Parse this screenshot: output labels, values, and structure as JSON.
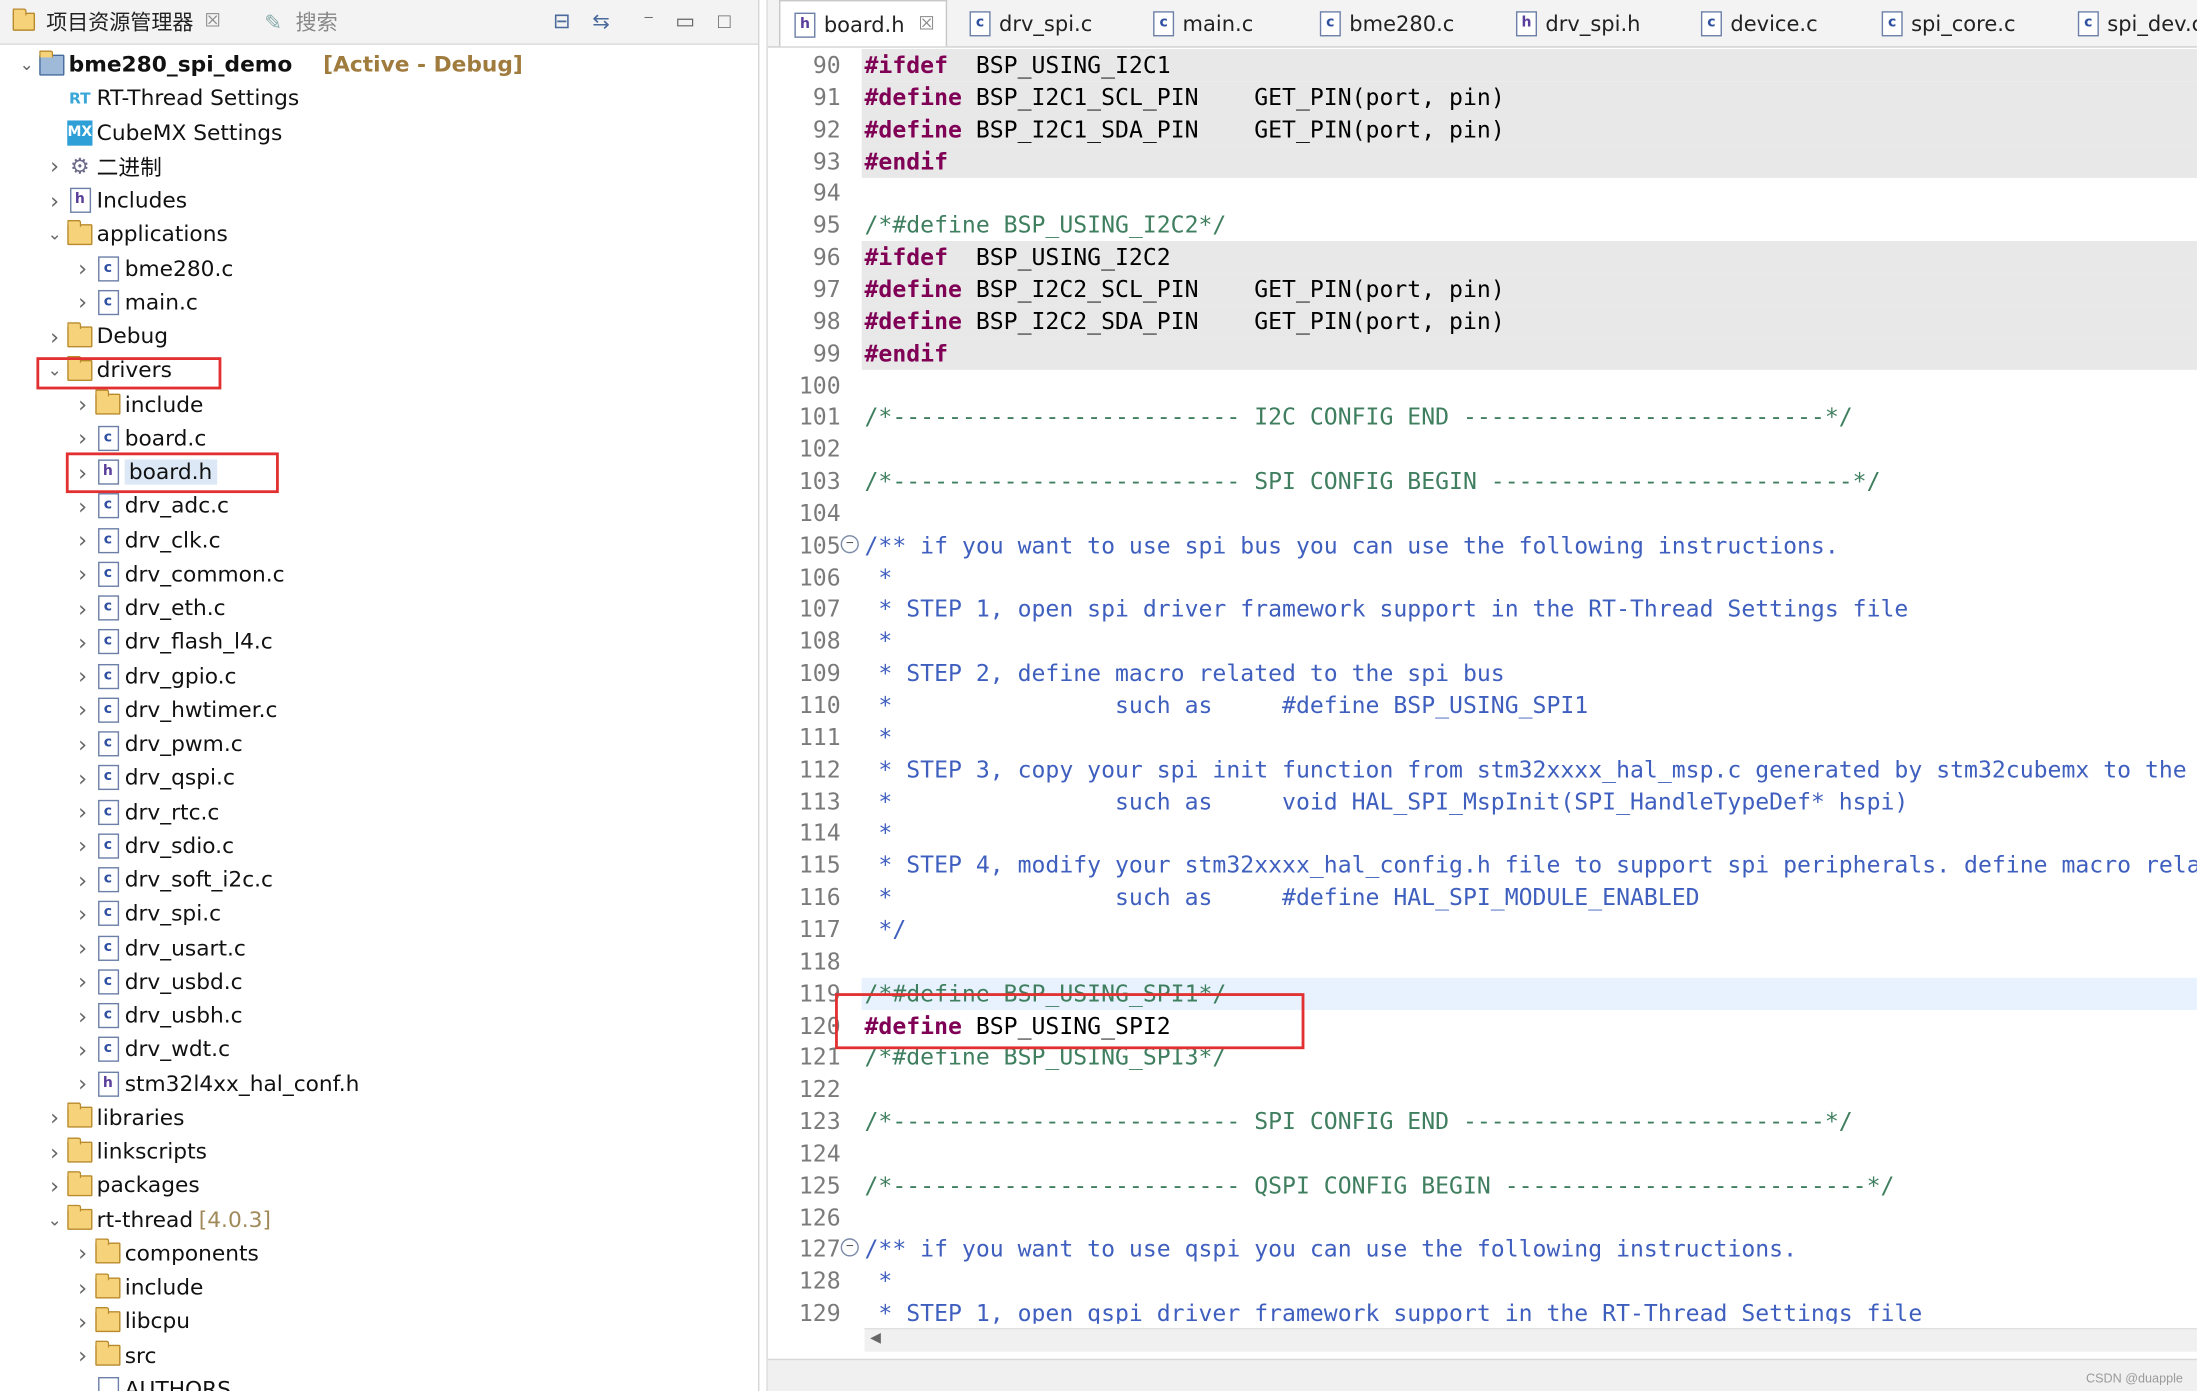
{
  "left_panel": {
    "tab_active": "项目资源管理器",
    "tab_close": "☒",
    "tab_inactive": "搜索",
    "tree": [
      {
        "label": "bme280_spi_demo",
        "annot": "[Active - Debug]",
        "depth": 0,
        "chev": "open",
        "icon": "project"
      },
      {
        "label": "RT-Thread Settings",
        "depth": 1,
        "chev": "none",
        "icon": "rt"
      },
      {
        "label": "CubeMX Settings",
        "depth": 1,
        "chev": "none",
        "icon": "mx"
      },
      {
        "label": "二进制",
        "depth": 1,
        "chev": "closed",
        "icon": "gear"
      },
      {
        "label": "Includes",
        "depth": 1,
        "chev": "closed",
        "icon": "includes"
      },
      {
        "label": "applications",
        "depth": 1,
        "chev": "open",
        "icon": "folder"
      },
      {
        "label": "bme280.c",
        "depth": 2,
        "chev": "closed",
        "icon": "c"
      },
      {
        "label": "main.c",
        "depth": 2,
        "chev": "closed",
        "icon": "c"
      },
      {
        "label": "Debug",
        "depth": 1,
        "chev": "closed",
        "icon": "folder"
      },
      {
        "label": "drivers",
        "depth": 1,
        "chev": "open",
        "icon": "folder"
      },
      {
        "label": "include",
        "depth": 2,
        "chev": "closed",
        "icon": "folder"
      },
      {
        "label": "board.c",
        "depth": 2,
        "chev": "closed",
        "icon": "c"
      },
      {
        "label": "board.h",
        "depth": 2,
        "chev": "closed",
        "icon": "h",
        "selected": true
      },
      {
        "label": "drv_adc.c",
        "depth": 2,
        "chev": "closed",
        "icon": "c"
      },
      {
        "label": "drv_clk.c",
        "depth": 2,
        "chev": "closed",
        "icon": "c"
      },
      {
        "label": "drv_common.c",
        "depth": 2,
        "chev": "closed",
        "icon": "c"
      },
      {
        "label": "drv_eth.c",
        "depth": 2,
        "chev": "closed",
        "icon": "c"
      },
      {
        "label": "drv_flash_l4.c",
        "depth": 2,
        "chev": "closed",
        "icon": "c"
      },
      {
        "label": "drv_gpio.c",
        "depth": 2,
        "chev": "closed",
        "icon": "c"
      },
      {
        "label": "drv_hwtimer.c",
        "depth": 2,
        "chev": "closed",
        "icon": "c"
      },
      {
        "label": "drv_pwm.c",
        "depth": 2,
        "chev": "closed",
        "icon": "c"
      },
      {
        "label": "drv_qspi.c",
        "depth": 2,
        "chev": "closed",
        "icon": "c"
      },
      {
        "label": "drv_rtc.c",
        "depth": 2,
        "chev": "closed",
        "icon": "c"
      },
      {
        "label": "drv_sdio.c",
        "depth": 2,
        "chev": "closed",
        "icon": "c"
      },
      {
        "label": "drv_soft_i2c.c",
        "depth": 2,
        "chev": "closed",
        "icon": "c"
      },
      {
        "label": "drv_spi.c",
        "depth": 2,
        "chev": "closed",
        "icon": "c"
      },
      {
        "label": "drv_usart.c",
        "depth": 2,
        "chev": "closed",
        "icon": "c"
      },
      {
        "label": "drv_usbd.c",
        "depth": 2,
        "chev": "closed",
        "icon": "c"
      },
      {
        "label": "drv_usbh.c",
        "depth": 2,
        "chev": "closed",
        "icon": "c"
      },
      {
        "label": "drv_wdt.c",
        "depth": 2,
        "chev": "closed",
        "icon": "c"
      },
      {
        "label": "stm32l4xx_hal_conf.h",
        "depth": 2,
        "chev": "closed",
        "icon": "h"
      },
      {
        "label": "libraries",
        "depth": 1,
        "chev": "closed",
        "icon": "folder"
      },
      {
        "label": "linkscripts",
        "depth": 1,
        "chev": "closed",
        "icon": "folder"
      },
      {
        "label": "packages",
        "depth": 1,
        "chev": "closed",
        "icon": "folder"
      },
      {
        "label": "rt-thread",
        "annot": "[4.0.3]",
        "depth": 1,
        "chev": "open",
        "icon": "folder"
      },
      {
        "label": "components",
        "depth": 2,
        "chev": "closed",
        "icon": "folder"
      },
      {
        "label": "include",
        "depth": 2,
        "chev": "closed",
        "icon": "folder"
      },
      {
        "label": "libcpu",
        "depth": 2,
        "chev": "closed",
        "icon": "folder"
      },
      {
        "label": "src",
        "depth": 2,
        "chev": "closed",
        "icon": "folder"
      },
      {
        "label": "AUTHORS",
        "depth": 2,
        "chev": "none",
        "icon": "file"
      }
    ]
  },
  "editor": {
    "tabs": [
      {
        "label": "board.h",
        "icon": "h",
        "active": true,
        "close": "☒"
      },
      {
        "label": "drv_spi.c",
        "icon": "c"
      },
      {
        "label": "main.c",
        "icon": "c"
      },
      {
        "label": "bme280.c",
        "icon": "c"
      },
      {
        "label": "drv_spi.h",
        "icon": "h"
      },
      {
        "label": "device.c",
        "icon": "c"
      },
      {
        "label": "spi_core.c",
        "icon": "c"
      },
      {
        "label": "spi_dev.c",
        "icon": "c"
      }
    ],
    "lines": [
      {
        "n": "90",
        "shade": true,
        "parts": [
          [
            "kw",
            "#ifdef"
          ],
          [
            "",
            "  BSP_USING_I2C1"
          ]
        ]
      },
      {
        "n": "91",
        "shade": true,
        "parts": [
          [
            "kw",
            "#define"
          ],
          [
            "",
            " BSP_I2C1_SCL_PIN    GET_PIN(port, pin)"
          ]
        ]
      },
      {
        "n": "92",
        "shade": true,
        "parts": [
          [
            "kw",
            "#define"
          ],
          [
            "",
            " BSP_I2C1_SDA_PIN    GET_PIN(port, pin)"
          ]
        ]
      },
      {
        "n": "93",
        "shade": true,
        "parts": [
          [
            "kw",
            "#endif"
          ]
        ]
      },
      {
        "n": "94",
        "parts": []
      },
      {
        "n": "95",
        "parts": [
          [
            "cmg",
            "/*#define BSP_USING_I2C2*/"
          ]
        ]
      },
      {
        "n": "96",
        "shade": true,
        "parts": [
          [
            "kw",
            "#ifdef"
          ],
          [
            "",
            "  BSP_USING_I2C2"
          ]
        ]
      },
      {
        "n": "97",
        "shade": true,
        "parts": [
          [
            "kw",
            "#define"
          ],
          [
            "",
            " BSP_I2C2_SCL_PIN    GET_PIN(port, pin)"
          ]
        ]
      },
      {
        "n": "98",
        "shade": true,
        "parts": [
          [
            "kw",
            "#define"
          ],
          [
            "",
            " BSP_I2C2_SDA_PIN    GET_PIN(port, pin)"
          ]
        ]
      },
      {
        "n": "99",
        "shade": true,
        "parts": [
          [
            "kw",
            "#endif"
          ]
        ]
      },
      {
        "n": "100",
        "parts": []
      },
      {
        "n": "101",
        "parts": [
          [
            "cmg",
            "/*------------------------- I2C CONFIG END --------------------------*/"
          ]
        ]
      },
      {
        "n": "102",
        "parts": []
      },
      {
        "n": "103",
        "parts": [
          [
            "cmg",
            "/*------------------------- SPI CONFIG BEGIN --------------------------*/"
          ]
        ]
      },
      {
        "n": "104",
        "parts": []
      },
      {
        "n": "105",
        "fold": true,
        "parts": [
          [
            "cm",
            "/** if you want to use spi bus you can use the following instructions."
          ]
        ]
      },
      {
        "n": "106",
        "parts": [
          [
            "cm",
            " *"
          ]
        ]
      },
      {
        "n": "107",
        "parts": [
          [
            "cm",
            " * STEP 1, open spi driver framework support in the RT-Thread Settings file"
          ]
        ]
      },
      {
        "n": "108",
        "parts": [
          [
            "cm",
            " *"
          ]
        ]
      },
      {
        "n": "109",
        "parts": [
          [
            "cm",
            " * STEP 2, define macro related to the spi bus"
          ]
        ]
      },
      {
        "n": "110",
        "parts": [
          [
            "cm",
            " *                such as     #define BSP_USING_SPI1"
          ]
        ]
      },
      {
        "n": "111",
        "parts": [
          [
            "cm",
            " *"
          ]
        ]
      },
      {
        "n": "112",
        "parts": [
          [
            "cm",
            " * STEP 3, copy your spi init function from stm32xxxx_hal_msp.c generated by stm32cubemx to the"
          ]
        ]
      },
      {
        "n": "113",
        "parts": [
          [
            "cm",
            " *                such as     void HAL_SPI_MspInit(SPI_HandleTypeDef* hspi)"
          ]
        ]
      },
      {
        "n": "114",
        "parts": [
          [
            "cm",
            " *"
          ]
        ]
      },
      {
        "n": "115",
        "parts": [
          [
            "cm",
            " * STEP 4, modify your stm32xxxx_hal_config.h file to support spi peripherals. define macro rela"
          ]
        ]
      },
      {
        "n": "116",
        "parts": [
          [
            "cm",
            " *                such as     #define HAL_SPI_MODULE_ENABLED"
          ]
        ]
      },
      {
        "n": "117",
        "parts": [
          [
            "cm",
            " */"
          ]
        ]
      },
      {
        "n": "118",
        "parts": []
      },
      {
        "n": "119",
        "cur": true,
        "parts": [
          [
            "cmg",
            "/*#define BSP_USING_SPI1*/"
          ]
        ]
      },
      {
        "n": "120",
        "parts": [
          [
            "kw",
            "#define"
          ],
          [
            "",
            " BSP_USING_SPI2"
          ]
        ]
      },
      {
        "n": "121",
        "parts": [
          [
            "cmg",
            "/*#define BSP_USING_SPI3*/"
          ]
        ]
      },
      {
        "n": "122",
        "parts": []
      },
      {
        "n": "123",
        "parts": [
          [
            "cmg",
            "/*------------------------- SPI CONFIG END --------------------------*/"
          ]
        ]
      },
      {
        "n": "124",
        "parts": []
      },
      {
        "n": "125",
        "parts": [
          [
            "cmg",
            "/*------------------------- QSPI CONFIG BEGIN --------------------------*/"
          ]
        ]
      },
      {
        "n": "126",
        "parts": []
      },
      {
        "n": "127",
        "fold": true,
        "parts": [
          [
            "cm",
            "/** if you want to use qspi you can use the following instructions."
          ]
        ]
      },
      {
        "n": "128",
        "parts": [
          [
            "cm",
            " *"
          ]
        ]
      },
      {
        "n": "129",
        "parts": [
          [
            "cm",
            " * STEP 1, open qspi driver framework support in the RT-Thread Settings file"
          ]
        ]
      }
    ]
  },
  "watermark": "CSDN @duapple"
}
